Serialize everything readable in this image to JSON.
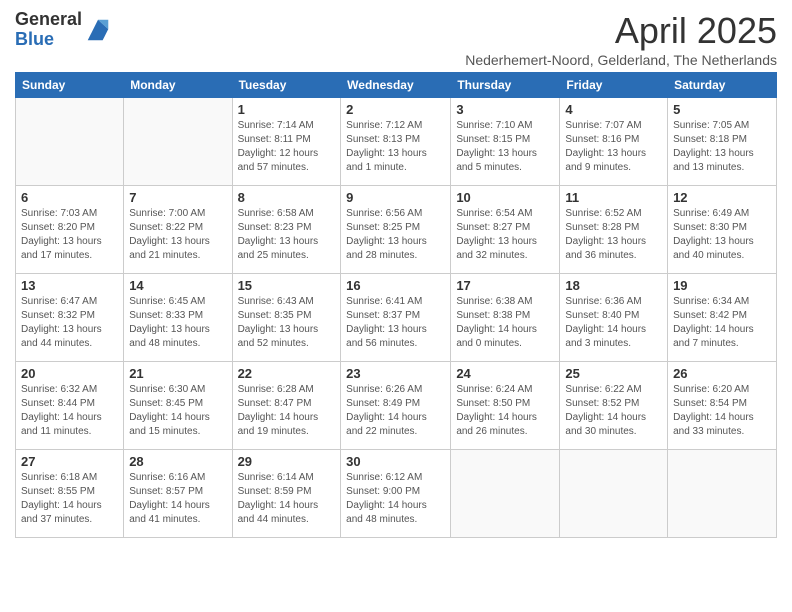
{
  "logo": {
    "general": "General",
    "blue": "Blue"
  },
  "title": "April 2025",
  "subtitle": "Nederhemert-Noord, Gelderland, The Netherlands",
  "days_of_week": [
    "Sunday",
    "Monday",
    "Tuesday",
    "Wednesday",
    "Thursday",
    "Friday",
    "Saturday"
  ],
  "weeks": [
    [
      {
        "day": "",
        "info": ""
      },
      {
        "day": "",
        "info": ""
      },
      {
        "day": "1",
        "info": "Sunrise: 7:14 AM\nSunset: 8:11 PM\nDaylight: 12 hours and 57 minutes."
      },
      {
        "day": "2",
        "info": "Sunrise: 7:12 AM\nSunset: 8:13 PM\nDaylight: 13 hours and 1 minute."
      },
      {
        "day": "3",
        "info": "Sunrise: 7:10 AM\nSunset: 8:15 PM\nDaylight: 13 hours and 5 minutes."
      },
      {
        "day": "4",
        "info": "Sunrise: 7:07 AM\nSunset: 8:16 PM\nDaylight: 13 hours and 9 minutes."
      },
      {
        "day": "5",
        "info": "Sunrise: 7:05 AM\nSunset: 8:18 PM\nDaylight: 13 hours and 13 minutes."
      }
    ],
    [
      {
        "day": "6",
        "info": "Sunrise: 7:03 AM\nSunset: 8:20 PM\nDaylight: 13 hours and 17 minutes."
      },
      {
        "day": "7",
        "info": "Sunrise: 7:00 AM\nSunset: 8:22 PM\nDaylight: 13 hours and 21 minutes."
      },
      {
        "day": "8",
        "info": "Sunrise: 6:58 AM\nSunset: 8:23 PM\nDaylight: 13 hours and 25 minutes."
      },
      {
        "day": "9",
        "info": "Sunrise: 6:56 AM\nSunset: 8:25 PM\nDaylight: 13 hours and 28 minutes."
      },
      {
        "day": "10",
        "info": "Sunrise: 6:54 AM\nSunset: 8:27 PM\nDaylight: 13 hours and 32 minutes."
      },
      {
        "day": "11",
        "info": "Sunrise: 6:52 AM\nSunset: 8:28 PM\nDaylight: 13 hours and 36 minutes."
      },
      {
        "day": "12",
        "info": "Sunrise: 6:49 AM\nSunset: 8:30 PM\nDaylight: 13 hours and 40 minutes."
      }
    ],
    [
      {
        "day": "13",
        "info": "Sunrise: 6:47 AM\nSunset: 8:32 PM\nDaylight: 13 hours and 44 minutes."
      },
      {
        "day": "14",
        "info": "Sunrise: 6:45 AM\nSunset: 8:33 PM\nDaylight: 13 hours and 48 minutes."
      },
      {
        "day": "15",
        "info": "Sunrise: 6:43 AM\nSunset: 8:35 PM\nDaylight: 13 hours and 52 minutes."
      },
      {
        "day": "16",
        "info": "Sunrise: 6:41 AM\nSunset: 8:37 PM\nDaylight: 13 hours and 56 minutes."
      },
      {
        "day": "17",
        "info": "Sunrise: 6:38 AM\nSunset: 8:38 PM\nDaylight: 14 hours and 0 minutes."
      },
      {
        "day": "18",
        "info": "Sunrise: 6:36 AM\nSunset: 8:40 PM\nDaylight: 14 hours and 3 minutes."
      },
      {
        "day": "19",
        "info": "Sunrise: 6:34 AM\nSunset: 8:42 PM\nDaylight: 14 hours and 7 minutes."
      }
    ],
    [
      {
        "day": "20",
        "info": "Sunrise: 6:32 AM\nSunset: 8:44 PM\nDaylight: 14 hours and 11 minutes."
      },
      {
        "day": "21",
        "info": "Sunrise: 6:30 AM\nSunset: 8:45 PM\nDaylight: 14 hours and 15 minutes."
      },
      {
        "day": "22",
        "info": "Sunrise: 6:28 AM\nSunset: 8:47 PM\nDaylight: 14 hours and 19 minutes."
      },
      {
        "day": "23",
        "info": "Sunrise: 6:26 AM\nSunset: 8:49 PM\nDaylight: 14 hours and 22 minutes."
      },
      {
        "day": "24",
        "info": "Sunrise: 6:24 AM\nSunset: 8:50 PM\nDaylight: 14 hours and 26 minutes."
      },
      {
        "day": "25",
        "info": "Sunrise: 6:22 AM\nSunset: 8:52 PM\nDaylight: 14 hours and 30 minutes."
      },
      {
        "day": "26",
        "info": "Sunrise: 6:20 AM\nSunset: 8:54 PM\nDaylight: 14 hours and 33 minutes."
      }
    ],
    [
      {
        "day": "27",
        "info": "Sunrise: 6:18 AM\nSunset: 8:55 PM\nDaylight: 14 hours and 37 minutes."
      },
      {
        "day": "28",
        "info": "Sunrise: 6:16 AM\nSunset: 8:57 PM\nDaylight: 14 hours and 41 minutes."
      },
      {
        "day": "29",
        "info": "Sunrise: 6:14 AM\nSunset: 8:59 PM\nDaylight: 14 hours and 44 minutes."
      },
      {
        "day": "30",
        "info": "Sunrise: 6:12 AM\nSunset: 9:00 PM\nDaylight: 14 hours and 48 minutes."
      },
      {
        "day": "",
        "info": ""
      },
      {
        "day": "",
        "info": ""
      },
      {
        "day": "",
        "info": ""
      }
    ]
  ]
}
